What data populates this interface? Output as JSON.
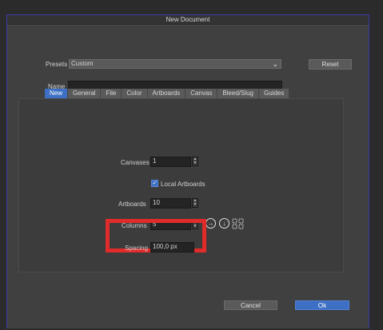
{
  "dialog": {
    "title": "New Document"
  },
  "presets": {
    "label": "Presets",
    "value": "Custom",
    "reset_label": "Reset"
  },
  "name": {
    "label": "Name",
    "value": ""
  },
  "tabs": [
    {
      "label": "New",
      "active": true
    },
    {
      "label": "General"
    },
    {
      "label": "File"
    },
    {
      "label": "Color"
    },
    {
      "label": "Artboards"
    },
    {
      "label": "Canvas"
    },
    {
      "label": "Bleed/Slug"
    },
    {
      "label": "Guides"
    }
  ],
  "form": {
    "canvases": {
      "label": "Canvases",
      "value": "1"
    },
    "local_artboards": {
      "label": "Local Artboards",
      "checked": true
    },
    "artboards": {
      "label": "Artboards",
      "value": "10"
    },
    "columns": {
      "label": "Columns",
      "value": "5"
    },
    "spacing": {
      "label": "Spacing",
      "value": "100,0 px"
    }
  },
  "footer": {
    "cancel_label": "Cancel",
    "ok_label": "Ok"
  },
  "colors": {
    "accent": "#3d6fc4",
    "highlight": "#e12b2b"
  },
  "icons": [
    "chevron-down-icon",
    "arrow-right-circle-icon",
    "arrow-down-circle-icon",
    "grid-layout-icon"
  ]
}
